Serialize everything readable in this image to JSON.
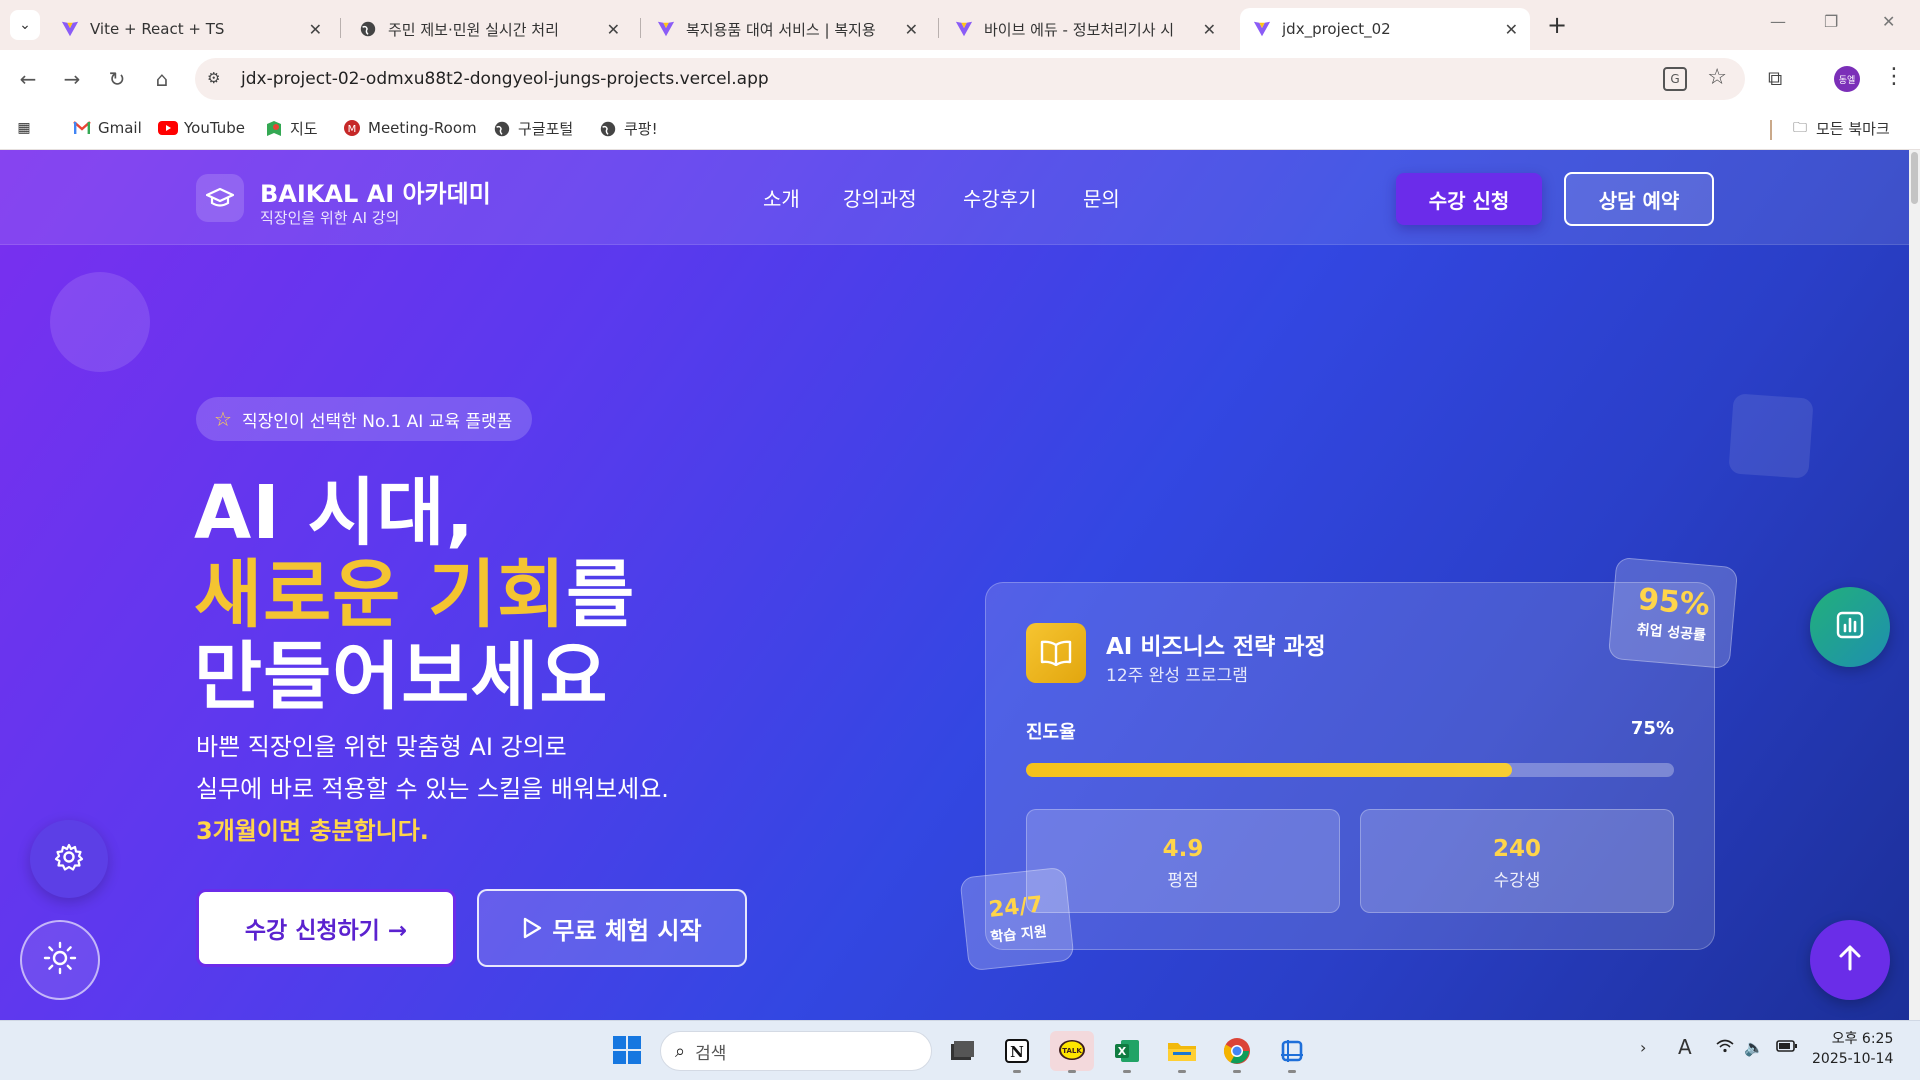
{
  "browser": {
    "tabs": [
      {
        "title": "Vite + React + TS",
        "favicon": "vite-icon",
        "active": false
      },
      {
        "title": "주민 제보·민원 실시간 처리",
        "favicon": "globe-icon",
        "active": false
      },
      {
        "title": "복지용품 대여 서비스 | 복지용",
        "favicon": "vite-icon",
        "active": false
      },
      {
        "title": "바이브 에듀 - 정보처리기사 시",
        "favicon": "vite-icon",
        "active": false
      },
      {
        "title": "jdx_project_02",
        "favicon": "vite-icon",
        "active": true
      }
    ],
    "url": "jdx-project-02-odmxu88t2-dongyeol-jungs-projects.vercel.app",
    "profile_initials": "동엘",
    "bookmarks": [
      {
        "label": "Gmail",
        "icon": "gmail-icon"
      },
      {
        "label": "YouTube",
        "icon": "youtube-icon"
      },
      {
        "label": "지도",
        "icon": "maps-icon"
      },
      {
        "label": "Meeting-Room",
        "icon": "meeting-room-icon"
      },
      {
        "label": "구글포털",
        "icon": "globe-icon"
      },
      {
        "label": "쿠팡!",
        "icon": "globe-icon"
      }
    ],
    "all_bookmarks_label": "모든 북마크"
  },
  "site": {
    "brand": "BAIKAL AI 아카데미",
    "brand_sub": "직장인을 위한 AI 강의",
    "nav": [
      "소개",
      "강의과정",
      "수강후기",
      "문의"
    ],
    "cta_apply": "수강 신청",
    "cta_consult": "상담 예약"
  },
  "hero": {
    "badge": "직장인이 선택한 No.1 AI 교육 플랫폼",
    "title_line1": "AI 시대,",
    "title_highlight": "새로운 기회",
    "title_line2_suffix": "를",
    "title_line3": "만들어보세요",
    "subtitle_line1": "바쁜 직장인을 위한 맞춤형 AI 강의로",
    "subtitle_line2": "실무에 바로 적용할 수 있는 스킬을 배워보세요.",
    "subtitle_highlight": "3개월이면 충분합니다.",
    "btn_primary": "수강 신청하기 →",
    "btn_secondary": "무료 체험 시작"
  },
  "card": {
    "title": "AI 비즈니스 전략 과정",
    "subtitle": "12주 완성 프로그램",
    "progress_label": "진도율",
    "progress_value": "75%",
    "progress_fraction": 0.75,
    "stats": [
      {
        "value": "4.9",
        "label": "평점"
      },
      {
        "value": "240",
        "label": "수강생"
      }
    ],
    "float_rate_value": "95%",
    "float_rate_label": "취업 성공률",
    "float_support_value": "24/7",
    "float_support_label": "학습 지원"
  },
  "taskbar": {
    "search_placeholder": "검색",
    "apps": [
      "file-explorer-icon",
      "notion-icon",
      "kakaotalk-icon",
      "excel-icon",
      "folder-icon",
      "chrome-icon",
      "snipping-tool-icon"
    ],
    "time": "오후 6:25",
    "date": "2025-10-14"
  },
  "colors": {
    "accent_purple": "#6b2cea",
    "highlight_gold": "#f4c431",
    "progress_fill": "#f5c21b"
  }
}
